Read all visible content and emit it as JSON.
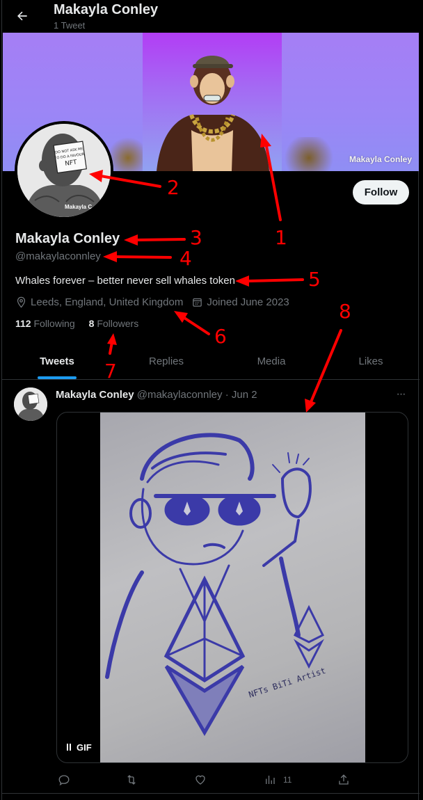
{
  "header": {
    "back_label": "Back",
    "title": "Makayla Conley",
    "subtitle": "1 Tweet"
  },
  "banner": {
    "watermark": "Makayla Conley"
  },
  "avatar": {
    "sign_text": [
      "DO NOT ASK ME",
      "TO DO A FAVOUR,",
      "NFT"
    ],
    "watermark": "Makayla C"
  },
  "profile": {
    "follow_label": "Follow",
    "display_name": "Makayla Conley",
    "handle": "@makaylaconnley",
    "bio": "Whales forever – better never sell whales token",
    "location": "Leeds, England, United Kingdom",
    "joined": "Joined June 2023",
    "following_count": "112",
    "following_label": "Following",
    "followers_count": "8",
    "followers_label": "Followers",
    "icons": {
      "location": "location-pin-icon",
      "joined": "calendar-icon"
    }
  },
  "tabs": [
    {
      "label": "Tweets",
      "active": true
    },
    {
      "label": "Replies",
      "active": false
    },
    {
      "label": "Media",
      "active": false
    },
    {
      "label": "Likes",
      "active": false
    }
  ],
  "tweet": {
    "author_name": "Makayla Conley",
    "author_handle": "@makaylaconnley",
    "separator": "·",
    "date": "Jun 2",
    "more_label": "···",
    "media": {
      "type": "GIF",
      "badge_label": "GIF",
      "caption_in_image": "NFTs BiTi Artist"
    },
    "actions": {
      "reply_count": "",
      "retweet_count": "",
      "like_count": "",
      "views_count": "11",
      "share_count": ""
    }
  },
  "annotations": {
    "labels": [
      "1",
      "2",
      "3",
      "4",
      "5",
      "6",
      "7",
      "8"
    ],
    "color": "#ff0000"
  },
  "colors": {
    "background": "#000000",
    "text_primary": "#e7e9ea",
    "text_secondary": "#71767b",
    "accent": "#1d9bf0",
    "border": "#2f3336",
    "follow_bg": "#eff3f4"
  }
}
